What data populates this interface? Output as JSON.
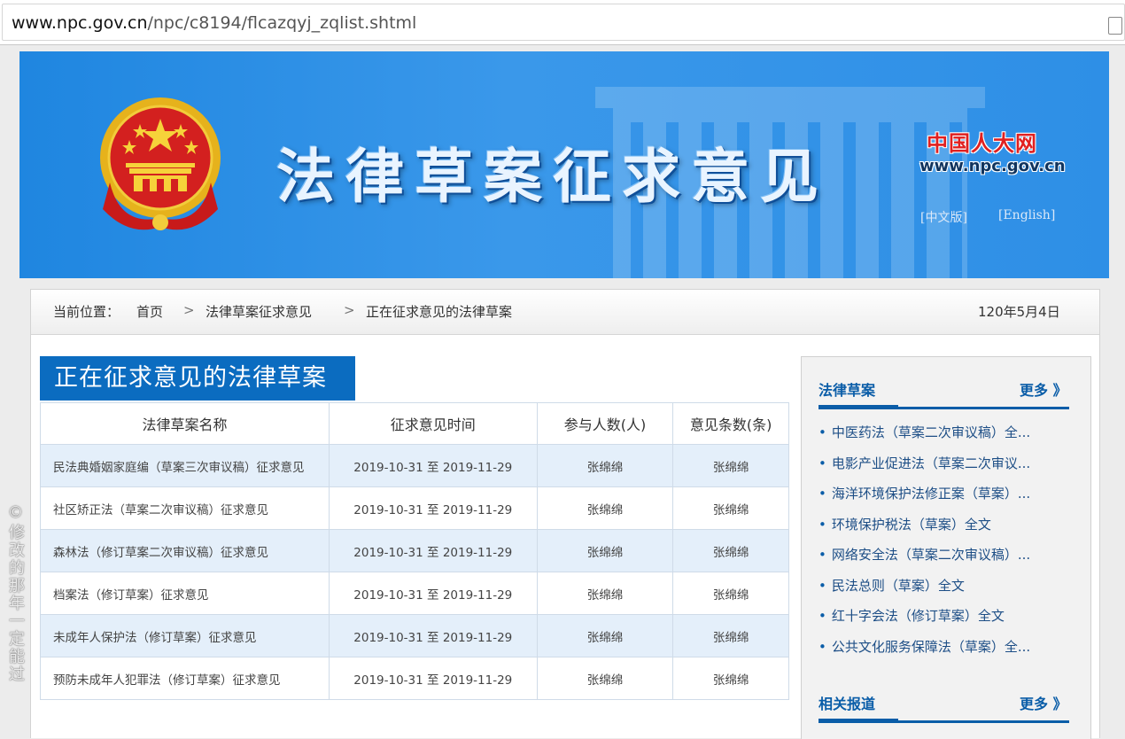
{
  "address_bar": {
    "host": "www.npc.gov.cn",
    "path": "/npc/c8194/flcazqyj_zqlist.shtml"
  },
  "banner": {
    "title": "法律草案征求意见",
    "site_name": "中国人大网",
    "site_url": "www.npc.gov.cn",
    "lang_cn": "[中文版]",
    "lang_en": "[English]",
    "background_color": "#2e8fe6"
  },
  "breadcrumb": {
    "label": "当前位置：",
    "items": [
      "首页",
      "法律草案征求意见",
      "正在征求意见的法律草案"
    ],
    "separator": ">",
    "date": "120年5月4日"
  },
  "section": {
    "title": "正在征求意见的法律草案",
    "accent_color": "#0b6cc0"
  },
  "table": {
    "headers": [
      "法律草案名称",
      "征求意见时间",
      "参与人数(人)",
      "意见条数(条)"
    ],
    "rows": [
      {
        "name": "民法典婚姻家庭编（草案三次审议稿）征求意见",
        "time": "2019-10-31  至  2019-11-29",
        "people": "张绵绵",
        "opinions": "张绵绵"
      },
      {
        "name": "社区矫正法（草案二次审议稿）征求意见",
        "time": "2019-10-31  至  2019-11-29",
        "people": "张绵绵",
        "opinions": "张绵绵"
      },
      {
        "name": "森林法（修订草案二次审议稿）征求意见",
        "time": "2019-10-31  至  2019-11-29",
        "people": "张绵绵",
        "opinions": "张绵绵"
      },
      {
        "name": "档案法（修订草案）征求意见",
        "time": "2019-10-31  至  2019-11-29",
        "people": "张绵绵",
        "opinions": "张绵绵"
      },
      {
        "name": "未成年人保护法（修订草案）征求意见",
        "time": "2019-10-31  至  2019-11-29",
        "people": "张绵绵",
        "opinions": "张绵绵"
      },
      {
        "name": "预防未成年人犯罪法（修订草案）征求意见",
        "time": "2019-10-31  至  2019-11-29",
        "people": "张绵绵",
        "opinions": "张绵绵"
      }
    ]
  },
  "sidebar": {
    "drafts_title": "法律草案",
    "more_label": "更多 》",
    "drafts": [
      "中医药法（草案二次审议稿）全...",
      "电影产业促进法（草案二次审议...",
      "海洋环境保护法修正案（草案）...",
      "环境保护税法（草案）全文",
      "网络安全法（草案二次审议稿）...",
      "民法总则（草案）全文",
      "红十字会法（修订草案）全文",
      "公共文化服务保障法（草案）全..."
    ],
    "reports_title": "相关报道",
    "reports_more_label": "更多 》"
  },
  "watermark": "©修改的那年一定能过"
}
